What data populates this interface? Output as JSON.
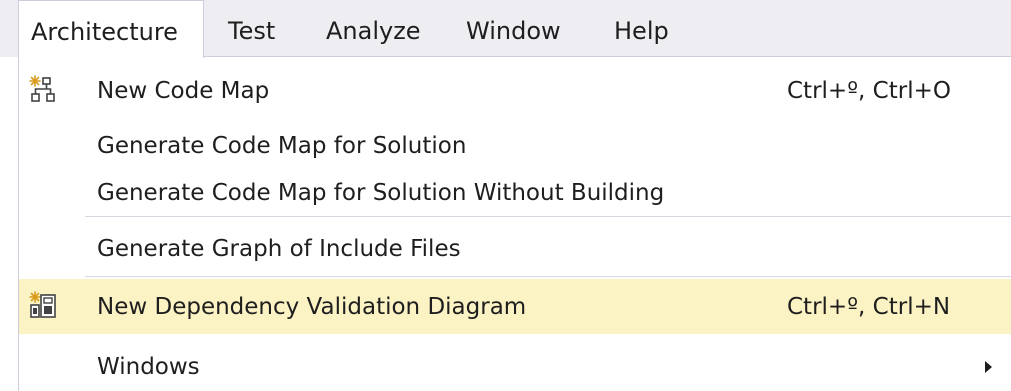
{
  "menubar": {
    "items": [
      {
        "label": "Architecture",
        "open": true
      },
      {
        "label": "Test"
      },
      {
        "label": "Analyze"
      },
      {
        "label": "Window"
      },
      {
        "label": "Help"
      }
    ]
  },
  "menu": {
    "items": [
      {
        "label": "New Code Map",
        "shortcut": "Ctrl+º, Ctrl+O",
        "icon": "code-map-icon"
      },
      {
        "label": "Generate Code Map for Solution"
      },
      {
        "label": "Generate Code Map for Solution Without Building"
      },
      {
        "label": "Generate Graph of Include Files"
      },
      {
        "label": "New Dependency Validation Diagram",
        "shortcut": "Ctrl+º, Ctrl+N",
        "icon": "dependency-diagram-icon",
        "highlighted": true
      },
      {
        "label": "Windows",
        "submenu": true
      }
    ]
  },
  "colors": {
    "menubar_bg": "#eeeef2",
    "highlight_bg": "#fcf3c4",
    "border": "#cccedb",
    "text": "#1e1e1e"
  }
}
